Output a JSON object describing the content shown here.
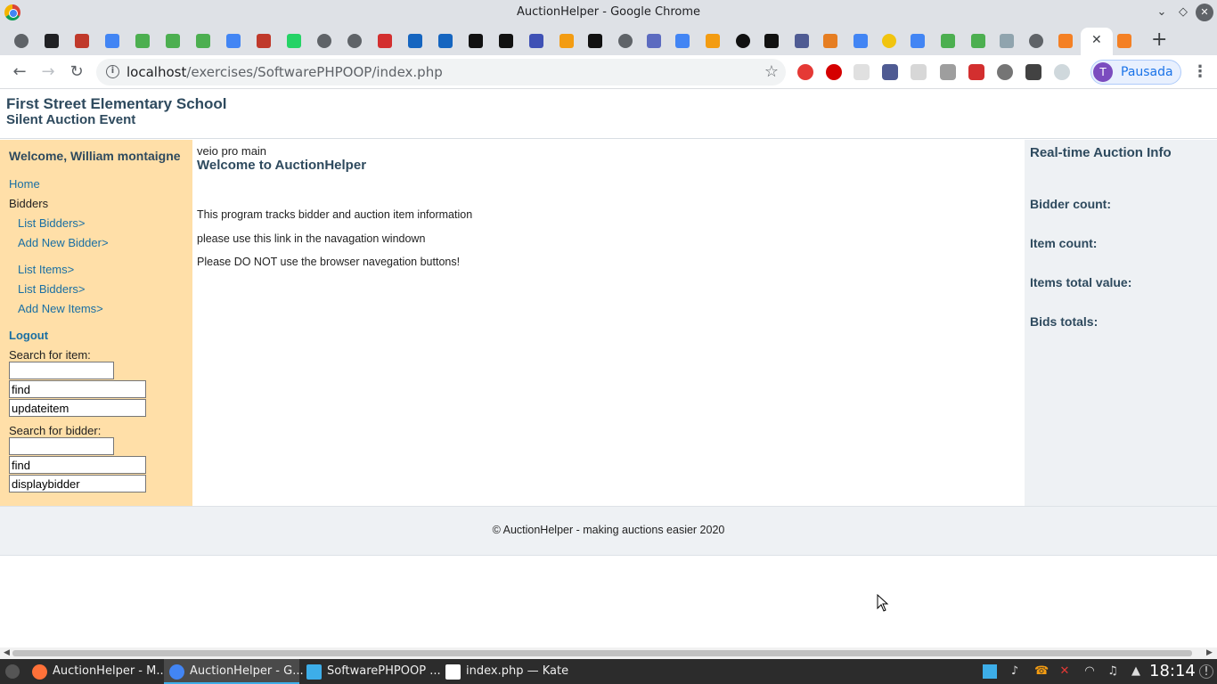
{
  "window": {
    "title": "AuctionHelper - Google Chrome"
  },
  "tabs": {
    "favicons": [
      {
        "name": "generic-tab-icon",
        "color": "#5f6368"
      },
      {
        "name": "wikipedia-tab-icon",
        "color": "#202124"
      },
      {
        "name": "extension-tab-icon",
        "color": "#c0392b"
      },
      {
        "name": "google-tab-icon",
        "color": "#4285f4"
      },
      {
        "name": "w3schools-tab-icon",
        "color": "#4caf50"
      },
      {
        "name": "w3schools-tab-icon",
        "color": "#4caf50"
      },
      {
        "name": "w3schools-tab-icon",
        "color": "#4caf50"
      },
      {
        "name": "google-tab-icon",
        "color": "#4285f4"
      },
      {
        "name": "shield-tab-icon",
        "color": "#c0392b"
      },
      {
        "name": "whatsapp-tab-icon",
        "color": "#25d366"
      },
      {
        "name": "generic-tab-icon",
        "color": "#5f6368"
      },
      {
        "name": "generic-tab-icon",
        "color": "#5f6368"
      },
      {
        "name": "star-tab-icon",
        "color": "#d32f2f"
      },
      {
        "name": "cube-tab-icon",
        "color": "#1565c0"
      },
      {
        "name": "cube-tab-icon",
        "color": "#1565c0"
      },
      {
        "name": "feather-tab-icon",
        "color": "#111"
      },
      {
        "name": "feather-tab-icon",
        "color": "#111"
      },
      {
        "name": "clock-tab-icon",
        "color": "#3f51b5"
      },
      {
        "name": "pma-tab-icon",
        "color": "#f39c12"
      },
      {
        "name": "github-tab-icon",
        "color": "#111"
      },
      {
        "name": "generic-tab-icon",
        "color": "#5f6368"
      },
      {
        "name": "grid-tab-icon",
        "color": "#5c6bc0"
      },
      {
        "name": "translate-tab-icon",
        "color": "#4285f4"
      },
      {
        "name": "pma-tab-icon",
        "color": "#f39c12"
      },
      {
        "name": "generic-tab-icon",
        "color": "#111"
      },
      {
        "name": "w-tab-icon",
        "color": "#111"
      },
      {
        "name": "php-tab-icon",
        "color": "#4f5b93"
      },
      {
        "name": "orange-tab-icon",
        "color": "#e67e22"
      },
      {
        "name": "google-tab-icon",
        "color": "#4285f4"
      },
      {
        "name": "generic-tab-icon",
        "color": "#f1c40f"
      },
      {
        "name": "translate-tab-icon",
        "color": "#4285f4"
      },
      {
        "name": "w3schools-tab-icon",
        "color": "#4caf50"
      },
      {
        "name": "w3schools-tab-icon",
        "color": "#4caf50"
      },
      {
        "name": "sun-tab-icon",
        "color": "#90a4ae"
      },
      {
        "name": "generic-tab-icon",
        "color": "#5f6368"
      },
      {
        "name": "stackoverflow-tab-icon",
        "color": "#f48024"
      },
      {
        "name": "stackoverflow-tab-icon",
        "color": "#f48024"
      }
    ],
    "close_glyph": "✕",
    "new_tab_glyph": "+"
  },
  "toolbar": {
    "back_glyph": "←",
    "forward_glyph": "→",
    "reload_glyph": "↻",
    "url_host": "localhost",
    "url_path": "/exercises/SoftwarePHPOOP/index.php",
    "star_glyph": "☆",
    "profile_initial": "T",
    "profile_label": "Pausada",
    "menu_glyph": "⋮"
  },
  "header": {
    "school": "First Street Elementary School",
    "event": "Silent Auction Event"
  },
  "nav": {
    "welcome": "Welcome, William montaigne",
    "home": "Home",
    "bidders": "Bidders",
    "list_bidders": "List Bidders>",
    "add_new_bidder": "Add New Bidder>",
    "list_items": "List Items>",
    "list_bidders_2": "List Bidders>",
    "add_new_items": "Add New Items>",
    "logout": "Logout",
    "search_item_label": "Search for item:",
    "search_item_value": "",
    "item_find_button": "find",
    "item_update_field": "updateitem",
    "search_bidder_label": "Search for bidder:",
    "search_bidder_value": "",
    "bidder_find_button": "find",
    "bidder_display_field": "displaybidder"
  },
  "main": {
    "debug_text": "veio pro main",
    "title": "Welcome to AuctionHelper",
    "p1": "This program tracks bidder and auction item information",
    "p2": "please use this link in the navagation windown",
    "p3": "Please DO NOT use the browser navegation buttons!"
  },
  "info_panel": {
    "title": "Real-time Auction Info",
    "bidder_count": "Bidder count:",
    "item_count": "Item count:",
    "items_total_value": "Items total value:",
    "bids_totals": "Bids totals:"
  },
  "footer": {
    "text": "© AuctionHelper - making auctions easier 2020"
  },
  "taskbar": {
    "tasks": [
      {
        "name": "firefox",
        "label": "AuctionHelper - M...",
        "color": "#ff7139"
      },
      {
        "name": "chrome",
        "label": "AuctionHelper - G...",
        "color": "#4285f4"
      },
      {
        "name": "file-manager",
        "label": "SoftwarePHPOOP ...",
        "color": "#3daee9"
      },
      {
        "name": "kate",
        "label": "index.php — Kate",
        "color": "#ffffff"
      }
    ],
    "clock": "18:14"
  }
}
